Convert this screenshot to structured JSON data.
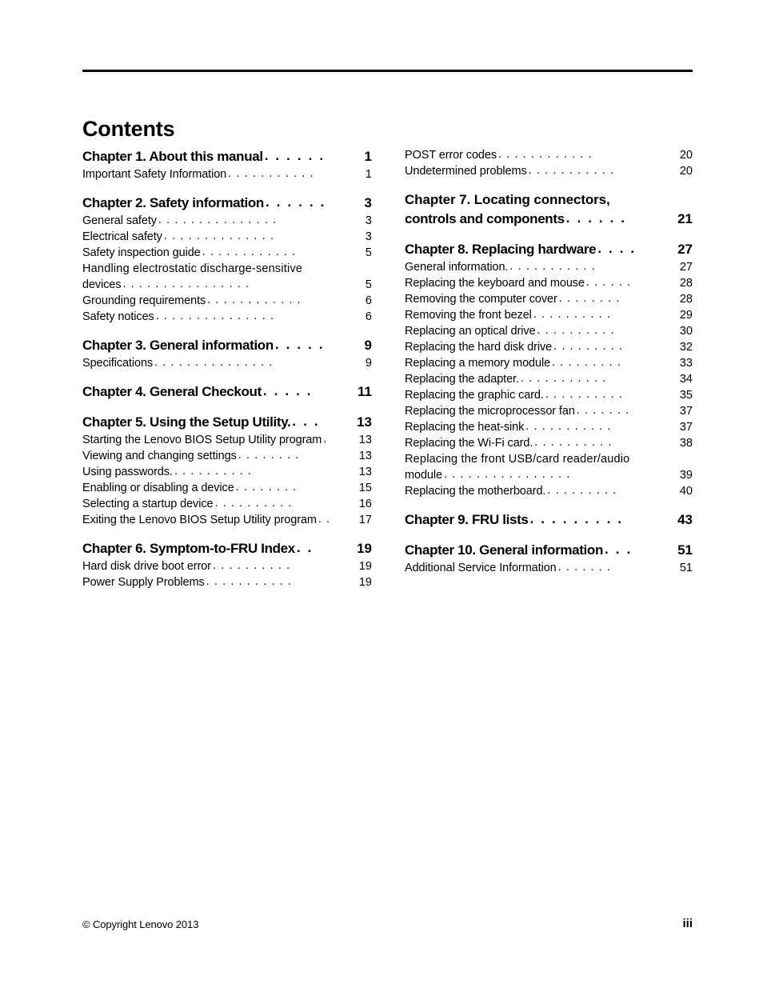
{
  "document": {
    "title": "Contents",
    "page_number": "iii",
    "copyright": "© Copyright Lenovo 2013"
  },
  "toc": {
    "left_column": [
      {
        "type": "chapter",
        "label": "Chapter 1. About this manual",
        "page": "1",
        "dots": 6,
        "spacer": false
      },
      {
        "type": "sub",
        "label": "Important Safety Information",
        "page": "1",
        "dots": 11,
        "spacer": false
      },
      {
        "type": "chapter",
        "label": "Chapter 2. Safety information",
        "page": "3",
        "dots": 6,
        "spacer": true
      },
      {
        "type": "sub",
        "label": "General safety",
        "page": "3",
        "dots": 15,
        "spacer": false
      },
      {
        "type": "sub",
        "label": "Electrical safety",
        "page": "3",
        "dots": 14,
        "spacer": false
      },
      {
        "type": "sub",
        "label": "Safety inspection guide",
        "page": "5",
        "dots": 12,
        "spacer": false
      },
      {
        "type": "sub",
        "label": "Handling electrostatic discharge-sensitive",
        "label2": "devices",
        "page": "5",
        "dots": 16,
        "spacer": false
      },
      {
        "type": "sub",
        "label": "Grounding requirements",
        "page": "6",
        "dots": 12,
        "spacer": false
      },
      {
        "type": "sub",
        "label": "Safety notices",
        "page": "6",
        "dots": 15,
        "spacer": false
      },
      {
        "type": "chapter",
        "label": "Chapter 3. General information",
        "page": "9",
        "dots": 5,
        "spacer": true
      },
      {
        "type": "sub",
        "label": "Specifications",
        "page": "9",
        "dots": 15,
        "spacer": false
      },
      {
        "type": "chapter",
        "label": "Chapter 4. General Checkout",
        "page": "11",
        "dots": 5,
        "spacer": true
      },
      {
        "type": "chapter",
        "label": "Chapter 5. Using the Setup Utility.",
        "page": "13",
        "dots": 3,
        "spacer": true
      },
      {
        "type": "sub",
        "label": "Starting the Lenovo BIOS Setup Utility program",
        "page": "13",
        "dots": 1,
        "spacer": false
      },
      {
        "type": "sub",
        "label": "Viewing and changing settings",
        "page": "13",
        "dots": 8,
        "spacer": false
      },
      {
        "type": "sub",
        "label": "Using passwords.",
        "page": "13",
        "dots": 10,
        "spacer": false
      },
      {
        "type": "sub",
        "label": "Enabling or disabling a device",
        "page": "15",
        "dots": 8,
        "spacer": false
      },
      {
        "type": "sub",
        "label": "Selecting a startup device",
        "page": "16",
        "dots": 10,
        "spacer": false
      },
      {
        "type": "sub",
        "label": "Exiting the Lenovo BIOS Setup Utility program",
        "page": "17",
        "dots": 2,
        "spacer": false
      },
      {
        "type": "chapter",
        "label": "Chapter 6. Symptom-to-FRU Index",
        "page": "19",
        "dots": 2,
        "spacer": true
      },
      {
        "type": "sub",
        "label": "Hard disk drive boot error",
        "page": "19",
        "dots": 10,
        "spacer": false
      },
      {
        "type": "sub",
        "label": "Power Supply Problems",
        "page": "19",
        "dots": 11,
        "spacer": false
      }
    ],
    "right_column": [
      {
        "type": "sub",
        "label": "POST error codes",
        "page": "20",
        "dots": 12,
        "spacer": false
      },
      {
        "type": "sub",
        "label": "Undetermined problems",
        "page": "20",
        "dots": 11,
        "spacer": false
      },
      {
        "type": "chapter",
        "label": "Chapter 7. Locating connectors,",
        "label2": "controls and components",
        "page": "21",
        "dots": 6,
        "spacer": true
      },
      {
        "type": "chapter",
        "label": "Chapter 8. Replacing hardware",
        "page": "27",
        "dots": 4,
        "spacer": true
      },
      {
        "type": "sub",
        "label": "General information.",
        "page": "27",
        "dots": 11,
        "spacer": false
      },
      {
        "type": "sub",
        "label": "Replacing the keyboard and mouse",
        "page": "28",
        "dots": 6,
        "spacer": false
      },
      {
        "type": "sub",
        "label": "Removing the computer cover",
        "page": "28",
        "dots": 8,
        "spacer": false
      },
      {
        "type": "sub",
        "label": "Removing the front bezel",
        "page": "29",
        "dots": 10,
        "spacer": false
      },
      {
        "type": "sub",
        "label": "Replacing an optical drive",
        "page": "30",
        "dots": 10,
        "spacer": false
      },
      {
        "type": "sub",
        "label": "Replacing the hard disk drive",
        "page": "32",
        "dots": 9,
        "spacer": false
      },
      {
        "type": "sub",
        "label": "Replacing a memory module",
        "page": "33",
        "dots": 9,
        "spacer": false
      },
      {
        "type": "sub",
        "label": "Replacing the adapter.",
        "page": "34",
        "dots": 11,
        "spacer": false
      },
      {
        "type": "sub",
        "label": "Replacing the graphic card.",
        "page": "35",
        "dots": 10,
        "spacer": false
      },
      {
        "type": "sub",
        "label": "Replacing the microprocessor fan",
        "page": "37",
        "dots": 7,
        "spacer": false
      },
      {
        "type": "sub",
        "label": "Replacing the heat-sink",
        "page": "37",
        "dots": 11,
        "spacer": false
      },
      {
        "type": "sub",
        "label": "Replacing the Wi-Fi card.",
        "page": "38",
        "dots": 10,
        "spacer": false
      },
      {
        "type": "sub",
        "label": "Replacing the front USB/card reader/audio",
        "label2": "module",
        "page": "39",
        "dots": 16,
        "spacer": false
      },
      {
        "type": "sub",
        "label": "Replacing the motherboard.",
        "page": "40",
        "dots": 9,
        "spacer": false
      },
      {
        "type": "chapter",
        "label": "Chapter 9. FRU lists",
        "page": "43",
        "dots": 9,
        "spacer": true
      },
      {
        "type": "chapter",
        "label": "Chapter 10. General information",
        "page": "51",
        "dots": 3,
        "spacer": true
      },
      {
        "type": "sub",
        "label": "Additional Service Information",
        "page": "51",
        "dots": 7,
        "spacer": false
      }
    ]
  }
}
